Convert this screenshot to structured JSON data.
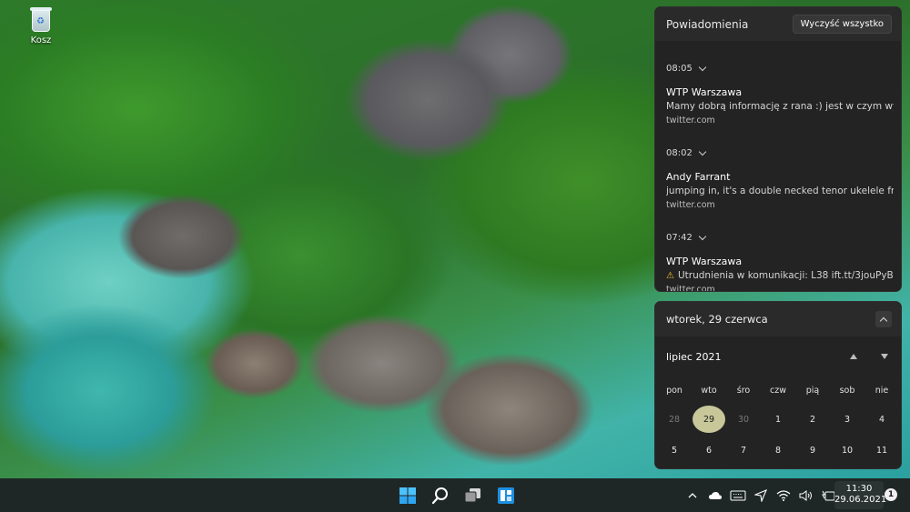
{
  "desktop": {
    "icons": [
      {
        "label": "Kosz",
        "icon": "recycle-bin-icon"
      }
    ]
  },
  "notifications": {
    "title": "Powiadomienia",
    "clear_all_label": "Wyczyść wszystko",
    "groups": [
      {
        "time": "08:05",
        "sender": "WTP Warszawa",
        "text": "Mamy dobrą informację z rana :) jest w czym wybier",
        "source": "twitter.com"
      },
      {
        "time": "08:02",
        "sender": "Andy Farrant",
        "text": "jumping in, it's a double necked tenor ukelele from",
        "source": "twitter.com"
      },
      {
        "time": "07:42",
        "sender": "WTP Warszawa",
        "text": "Utrudnienia w komunikacji: L38 ift.tt/3jouPyB",
        "source": "twitter.com",
        "icon": "warning-icon"
      }
    ]
  },
  "calendar": {
    "date_title": "wtorek, 29 czerwca",
    "month_label": "lipiec 2021",
    "weekdays": [
      "pon",
      "wto",
      "śro",
      "czw",
      "pią",
      "sob",
      "nie"
    ],
    "weeks": [
      [
        "28",
        "29",
        "30",
        "1",
        "2",
        "3",
        "4"
      ],
      [
        "5",
        "6",
        "7",
        "8",
        "9",
        "10",
        "11"
      ]
    ],
    "today": "29",
    "today_color": "#c7c79a"
  },
  "taskbar": {
    "center_icons": [
      "windows-start-icon",
      "search-icon",
      "task-view-icon",
      "widgets-icon"
    ],
    "tray_icons": [
      "chevron-up-icon",
      "onedrive-cloud-icon",
      "keyboard-icon",
      "location-icon",
      "wifi-icon",
      "volume-icon",
      "battery-charging-icon"
    ],
    "clock_time": "11:30",
    "clock_date": "29.06.2021",
    "notification_count": "1"
  },
  "colors": {
    "panel_bg": "#232323",
    "taskbar_bg": "#1f2726",
    "start_blue": "#4cc2ff"
  }
}
